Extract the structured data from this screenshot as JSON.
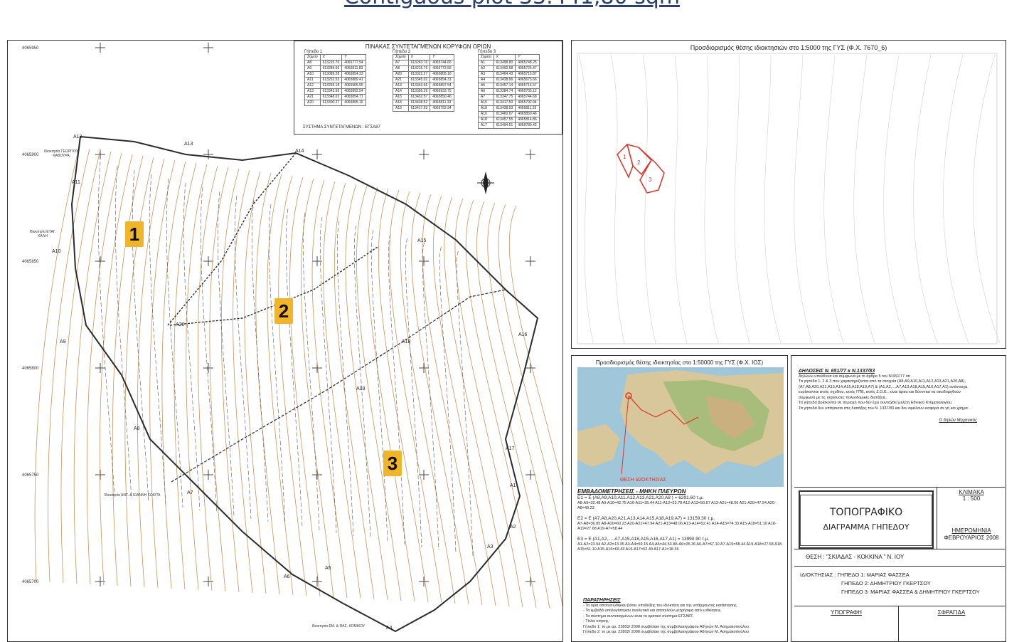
{
  "page_title": "Contiguous plot 33.441,80 sqm",
  "coord_table": {
    "title": "ΠΙΝΑΚΑΣ ΣΥΝΤΕΤΑΓΜΕΝΩΝ ΚΟΡΥΦΩΝ ΟΡΙΩΝ",
    "groups": [
      {
        "label": "Γήπεδο 1",
        "header": [
          "Σημείο",
          "X",
          "Y"
        ],
        "rows": [
          [
            "A8",
            "613215.76",
            "4065777.54"
          ],
          [
            "A9",
            "613284.66",
            "4065811.83"
          ],
          [
            "A10",
            "613089.28",
            "4065854.33"
          ],
          [
            "A11",
            "613252.53",
            "4065889.41"
          ],
          [
            "A12",
            "613259.18",
            "4065905.55"
          ],
          [
            "A13",
            "613343.66",
            "4065892.54"
          ],
          [
            "A21",
            "613348.02",
            "4065854.71"
          ],
          [
            "A20",
            "613300.27",
            "4065805.16"
          ]
        ]
      },
      {
        "label": "Γήπεδο 2",
        "header": [
          "Σημείο",
          "X",
          "Y"
        ],
        "rows": [
          [
            "A7",
            "613243.76",
            "4065744.66"
          ],
          [
            "A8",
            "613215.76",
            "4065773.56"
          ],
          [
            "A20",
            "613322.27",
            "4065805.16"
          ],
          [
            "A21",
            "613345.02",
            "4065854.31"
          ],
          [
            "A13",
            "613343.66",
            "4065897.54"
          ],
          [
            "A14",
            "613356.39",
            "4065933.75"
          ],
          [
            "A15",
            "613452.57",
            "4065850.46"
          ],
          [
            "A18",
            "613438.52",
            "4065811.33"
          ],
          [
            "A19",
            "613417.53",
            "4065792.94"
          ]
        ]
      },
      {
        "label": "Γήπεδο 3",
        "header": [
          "Σημείο",
          "X",
          "Y"
        ],
        "rows": [
          [
            "A1",
            "613498.80",
            "4065748.25"
          ],
          [
            "A2",
            "613492.58",
            "4065725.47"
          ],
          [
            "A3",
            "613464.43",
            "4065715.87"
          ],
          [
            "A4",
            "613438.66",
            "4065675.66"
          ],
          [
            "A5",
            "613457.14",
            "4065716.57"
          ],
          [
            "A6",
            "613384.74",
            "4065705.12"
          ],
          [
            "A7",
            "613347.75",
            "4065744.68"
          ],
          [
            "A15",
            "613417.50",
            "4065792.94"
          ],
          [
            "A18",
            "613438.53",
            "4065811.33"
          ],
          [
            "A16",
            "613460.67",
            "4065850.46"
          ],
          [
            "A18",
            "613457.55",
            "4065814.86"
          ],
          [
            "A17",
            "613494.51",
            "4065780.42"
          ]
        ]
      }
    ],
    "crs": "ΣΥΣΤΗΜΑ ΣΥΝΤΕΤΑΓΜΕΝΩΝ : ΕΓΣΑ87"
  },
  "grid_labels": [
    "4065950",
    "4065900",
    "4065850",
    "4065800",
    "4065750",
    "4065700"
  ],
  "plots": [
    {
      "number": "1"
    },
    {
      "number": "2"
    },
    {
      "number": "3"
    }
  ],
  "vertex_labels": [
    "A1",
    "A2",
    "A3",
    "A4",
    "A5",
    "A6",
    "A7",
    "A8",
    "A9",
    "A10",
    "A11",
    "A12",
    "A13",
    "A14",
    "A15",
    "A16",
    "A17",
    "A18",
    "A19",
    "A20"
  ],
  "owners_neighbours": [
    "Ιδιοκτησία ΓΕΩΡΓΙΟΥ ΚΑΒΟΥΡΑ",
    "Ιδιοκτησία ΕΥΑΓ. ΚΑΛΗ",
    "Ιδιοκτησία ΑΝΤ. & ΙΩΑΝΝΗ ΚΩΚΙΤΑ",
    "Ιδιοκτησία ΕΜ. & ΘΑΣ. ΚΟΜΙΚΟΥ"
  ],
  "loc5000": {
    "title": "Προσδιορισμός θέσης ιδιοκτησιών στο 1:5000 της ΓΥΣ (Φ.Χ. 7670_6)"
  },
  "loc50000": {
    "title": "Προσδιορισμός θέσης ιδιοκτησίας στο 1:50000 της ΓΥΣ (Φ.Χ. ΙΟΣ)",
    "marker": "ΘΕΣΗ ΙΔΙΟΚΤΗΣΙΑΣ"
  },
  "areas": {
    "title": "ΕΜΒΑΔΟΜΕΤΡΗΣΕΙΣ - ΜΗΚΗ ΠΛΕΥΡΩΝ",
    "e1": "E1 = E (A8,A9,A10,A11,A12,A13,A21,A20,A8 ) = 6291.60 τ.μ.",
    "e1_sides": "A8-A9=32.48  A9-A10=42.75  A10-A11=35.44  A11-A12=23.78  A12-A13=50.57  A13-A21=48.06  A21-A20=47.94  A20-A8=49.23",
    "e2": "E2 = E (A7,A8,A20,A21,A13,A14,A15,A18,A19,A7) = 13159.30 τ.μ.",
    "e2_sides": "A7-A8=36.85  A8-A20=60.23  A20-A21=47.94  A21-A13=48.06  A13-A14=52.41  A14-A15=74.33  A15-A18=51.10  A18-A19=27.68  A19-A7=58.44",
    "e3": "E3 = E (A1,A2,.....A7,A15,A18,A15,A16,A17,A1) = 13990.90 τ.μ.",
    "e3_sides": "A1-A2=23.94  A2-A3=13.35  A3-A4=59.15  A4-A5=44.53  A5-A6=25.36  A6-A7=57.10  A7-A15=58.44  A19-A18=27.68  A18-A15=51.10  A15-A16=69.43  A16-A17=52.49  A17-A1=18.36"
  },
  "notes": {
    "title": "ΠΑΡΑΤΗΡΗΣΕΙΣ",
    "lines": [
      "- Τα όρια αποτυπώθηκαν βάσει υποδείξης του ιδιοκτήτη και της υπάρχουσας κατάστασης.",
      "- Τα εμβαδά υπολογίστηκαν αναλυτικά και αποτελούν μετρήσιμα από ευθείασεις.",
      "- Τα σύστημα συντεταγμένων είναι το κρατικό σύστημα ΕΓΣΑ87.",
      "- Τίτλοι κτήσης:",
      "  Γήπεδο 1: το με αρ. 22803/ 2008 συμβόλαιο της συμβολαιογράφου Αθηνών Μ. Ασημακοπούλου",
      "  Γήπεδο 2: το με αρ. 22802/ 2008 συμβόλαιο της συμβολαιογράφου Αθηνών Μ. Ασημακοπούλου"
    ]
  },
  "declarations": {
    "title": "ΔΗΛΩΣΕΙΣ  Ν. 651/77  κ  Ν.1337/83",
    "lines": [
      "Δηλώνω υπεύθυνα και σύμφωνα με το άρθρο 5 του Ν.651/77 ότι",
      "Τα γήπεδα 1, 2 & 3 που χαρακτηρίζονται από τα στοιχεία (A8,A9,A10,A11,A12,A13,A21,A20,A8),",
      "(A7,A8,A20,A21,A13,A14,A15,A18,A19,A7) & (A1,A2,...,A7,A13,A18,A15,A16,A17,A1) αντίστοιχα,",
      "ευρίσκονται εκτός σχεδίου, εκτός ΓΠΕ, εκτός Ζ.Ο.Ε., είναι άρτια και δύνονται να οικοδομηθούν",
      "σύμφωνα με τις ισχύουσες πολεοδομικές διατάξεις.",
      "Τα γήπεδα βρίσκονται σε περιοχή που δεν έχει συνταχθεί μελέτη Εθνικού Κτηματολογίου.",
      "Τα γήπεδα δεν υπάγονται στις διατάξεις του Ν. 1337/83 και δεν οφείλουν εισφορά σε γη και χρήμα."
    ],
    "signature": "Ο δηλών Μηχανικός"
  },
  "title_block": {
    "main1": "ΤΟΠΟΓΡΑΦΙΚΟ",
    "main2": "ΔΙΑΓΡΑΜΜΑ ΓΗΠΕΔΟΥ",
    "scale_label": "ΚΛΙΜΑΚΑ",
    "scale_value": "1 : 500",
    "date_label": "ΗΜΕΡΟΜΗΝΙΑ",
    "date_value": "ΦΕΒΡΟΥΑΡΙΟΣ 2008",
    "location": "ΘΕΣΗ :   \"ΣΚΙΑΔΑΣ - ΚΟΚΚΙΝΑ \"  Ν. ΙΟΥ",
    "owner1": "ΙΔΙΟΚΤΗΣΙΑΣ : ΓΗΠΕΔΟ 1: ΜΑΡΙΑΣ ΦΑΣΣΕΑ",
    "owner2": "ΓΗΠΕΔΟ 2: ΔΗΜΗΤΡΙΟΥ ΓΚΕΡΤΣΟΥ",
    "owner3": "ΓΗΠΕΔΟ 3: ΜΑΡΙΑΣ ΦΑΣΣΕΑ & ΔΗΜΗΤΡΙΟΥ ΓΚΕΡΤΣΟΥ",
    "signature": "ΥΠΟΓΡΑΦΗ",
    "stamp": "ΣΦΡΑΓΙΔΑ"
  },
  "colors": {
    "contour": "#c9925a",
    "boundary": "#2b2b2b",
    "plot_badge": "#f1b52a",
    "locator": "#d9342b"
  }
}
